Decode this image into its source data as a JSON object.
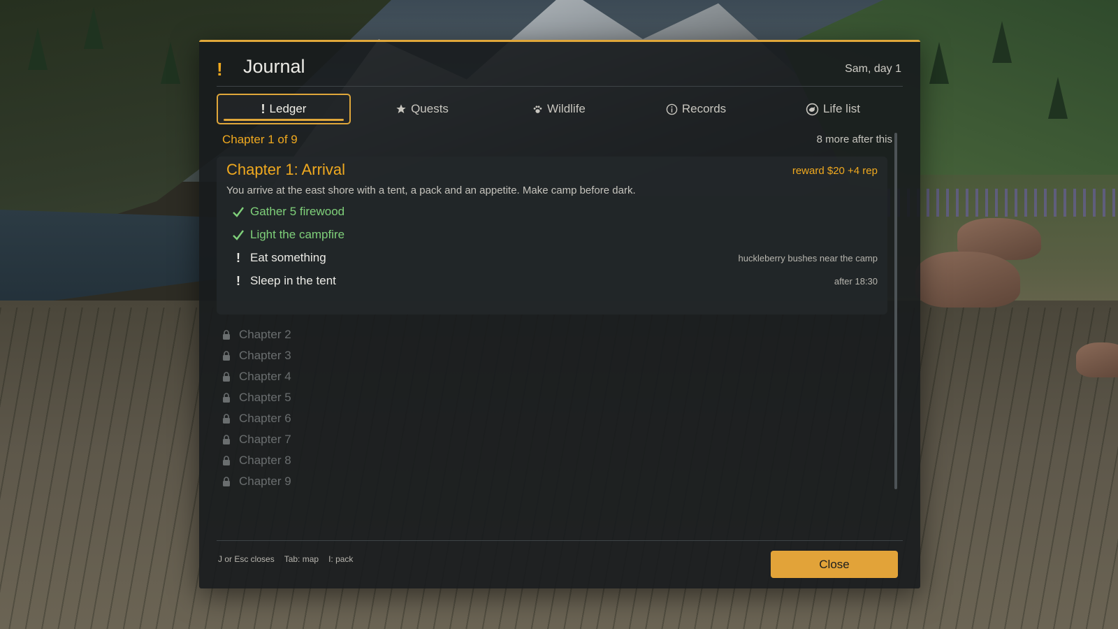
{
  "journal": {
    "title": "Journal",
    "header_icon": "exclamation-icon",
    "player_day": "Sam, day 1"
  },
  "tabs": [
    {
      "label": "Ledger",
      "icon": "exclamation-icon",
      "active": true
    },
    {
      "label": "Quests",
      "icon": "star-icon",
      "active": false
    },
    {
      "label": "Wildlife",
      "icon": "paw-icon",
      "active": false
    },
    {
      "label": "Records",
      "icon": "info-icon",
      "active": false
    },
    {
      "label": "Life list",
      "icon": "bird-badge-icon",
      "active": false
    }
  ],
  "progress": {
    "current": "Chapter 1 of 9",
    "remaining": "8 more after this"
  },
  "chapter": {
    "title": "Chapter 1: Arrival",
    "reward": "reward $20  +4 rep",
    "description": "You arrive at the east shore with a tent, a pack and an appetite. Make camp before dark.",
    "tasks": [
      {
        "label": "Gather 5 firewood",
        "status": "done",
        "icon": "check-icon",
        "hint": ""
      },
      {
        "label": "Light the campfire",
        "status": "done",
        "icon": "check-icon",
        "hint": ""
      },
      {
        "label": "Eat something",
        "status": "pending",
        "icon": "exclamation-icon",
        "hint": "huckleberry bushes near the camp"
      },
      {
        "label": "Sleep in the tent",
        "status": "pending",
        "icon": "exclamation-icon",
        "hint": "after 18:30"
      }
    ]
  },
  "locked_chapters": [
    "Chapter 2",
    "Chapter 3",
    "Chapter 4",
    "Chapter 5",
    "Chapter 6",
    "Chapter 7",
    "Chapter 8",
    "Chapter 9"
  ],
  "footer": {
    "hints": [
      "J or Esc closes",
      "Tab: map",
      "I: pack"
    ],
    "close_label": "Close"
  },
  "colors": {
    "accent": "#e0a73a",
    "done": "#7fd07a",
    "panel": "#171b1d"
  }
}
